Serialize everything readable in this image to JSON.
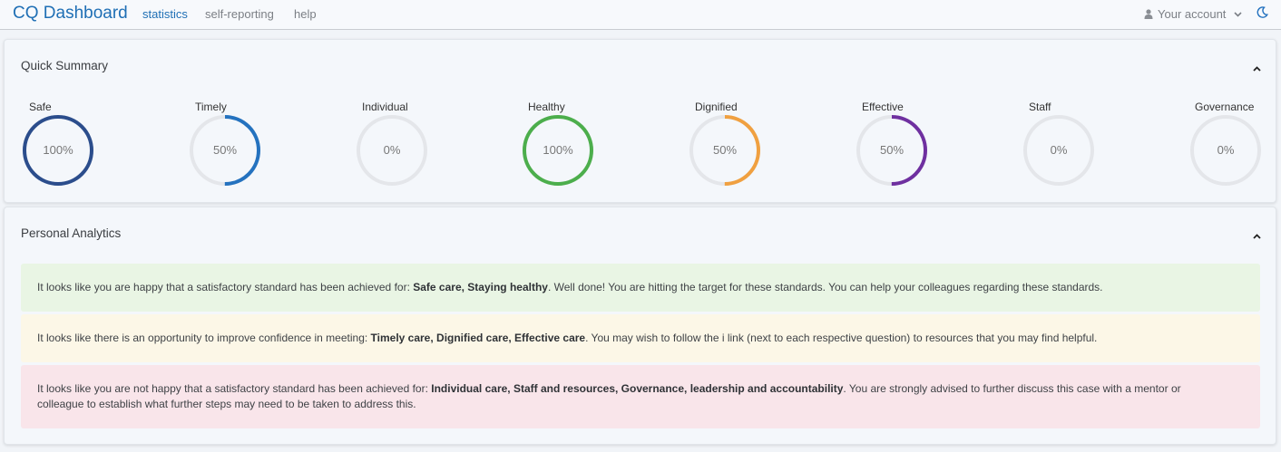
{
  "navbar": {
    "brand": "CQ Dashboard",
    "links": [
      {
        "label": "statistics",
        "active": true
      },
      {
        "label": "self-reporting",
        "active": false
      },
      {
        "label": "help",
        "active": false
      }
    ],
    "account_label": "Your account",
    "icons": [
      "user-icon",
      "chevron-down-icon",
      "moon-icon"
    ]
  },
  "summary": {
    "title": "Quick Summary",
    "gauges": [
      {
        "label": "Safe",
        "value": "100%",
        "fraction": 1.0,
        "color": "#2b4d8c"
      },
      {
        "label": "Timely",
        "value": "50%",
        "fraction": 0.5,
        "color": "#2472bf"
      },
      {
        "label": "Individual",
        "value": "0%",
        "fraction": 0.0,
        "color": "#9aa0a6"
      },
      {
        "label": "Healthy",
        "value": "100%",
        "fraction": 1.0,
        "color": "#4cae4c"
      },
      {
        "label": "Dignified",
        "value": "50%",
        "fraction": 0.5,
        "color": "#f0a040"
      },
      {
        "label": "Effective",
        "value": "50%",
        "fraction": 0.5,
        "color": "#6f30a0"
      },
      {
        "label": "Staff",
        "value": "0%",
        "fraction": 0.0,
        "color": "#9aa0a6"
      },
      {
        "label": "Governance",
        "value": "0%",
        "fraction": 0.0,
        "color": "#9aa0a6"
      }
    ],
    "track_color": "#e4e6ea"
  },
  "analytics": {
    "title": "Personal Analytics",
    "alerts": [
      {
        "type": "success",
        "prefix": "It looks like you are happy that a satisfactory standard has been achieved for: ",
        "bold": "Safe care, Staying healthy",
        "suffix": ". Well done! You are hitting the target for these standards. You can help your colleagues regarding these standards."
      },
      {
        "type": "warning",
        "prefix": "It looks like there is an opportunity to improve confidence in meeting: ",
        "bold": "Timely care, Dignified care, Effective care",
        "suffix": ". You may wish to follow the i link (next to each respective question) to resources that you may find helpful."
      },
      {
        "type": "danger",
        "prefix": "It looks like you are not happy that a satisfactory standard has been achieved for: ",
        "bold": "Individual care, Staff and resources, Governance, leadership and accountability",
        "suffix": ". You are strongly advised to further discuss this case with a mentor or colleague to establish what further steps may need to be taken to address this."
      }
    ]
  }
}
